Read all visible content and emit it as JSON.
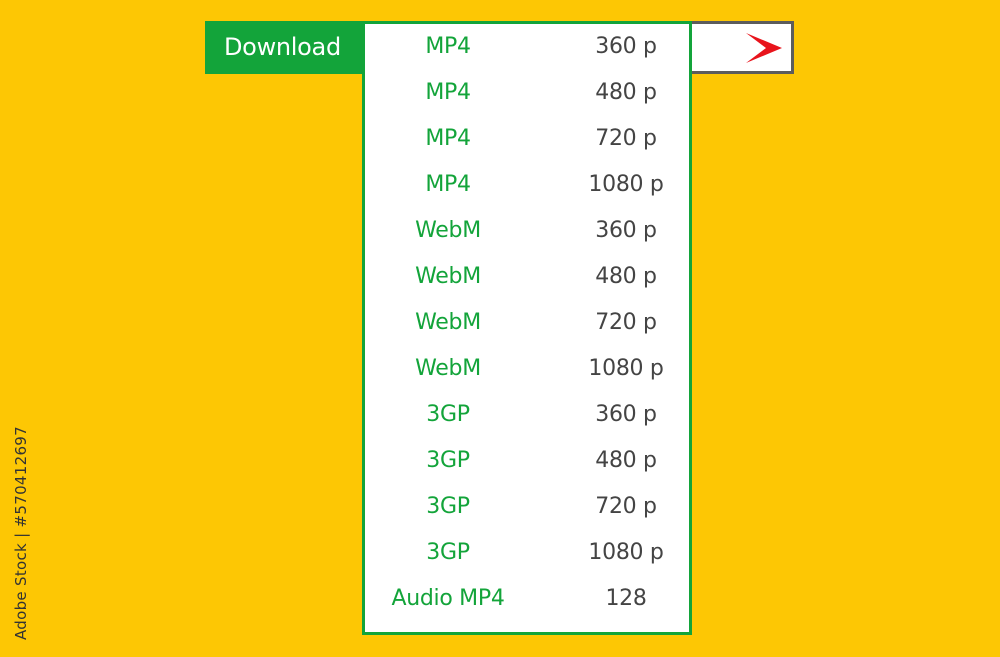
{
  "download_button": {
    "label": "Download"
  },
  "go_button": {
    "icon": "chevron-right-icon",
    "color": "#e8141c"
  },
  "formats": [
    {
      "name": "MP4",
      "quality": "360 p"
    },
    {
      "name": "MP4",
      "quality": "480 p"
    },
    {
      "name": "MP4",
      "quality": "720 p"
    },
    {
      "name": "MP4",
      "quality": "1080 p"
    },
    {
      "name": "WebM",
      "quality": "360 p"
    },
    {
      "name": "WebM",
      "quality": "480 p"
    },
    {
      "name": "WebM",
      "quality": "720 p"
    },
    {
      "name": "WebM",
      "quality": "1080 p"
    },
    {
      "name": "3GP",
      "quality": "360 p"
    },
    {
      "name": "3GP",
      "quality": "480 p"
    },
    {
      "name": "3GP",
      "quality": "720 p"
    },
    {
      "name": "3GP",
      "quality": "1080 p"
    },
    {
      "name": "Audio MP4",
      "quality": "128"
    }
  ],
  "watermark": {
    "stock_id": "Adobe Stock | #570412697"
  },
  "colors": {
    "background": "#fdc704",
    "accent_green": "#13a43a",
    "text_gray": "#444444",
    "arrow_red": "#e8141c"
  }
}
